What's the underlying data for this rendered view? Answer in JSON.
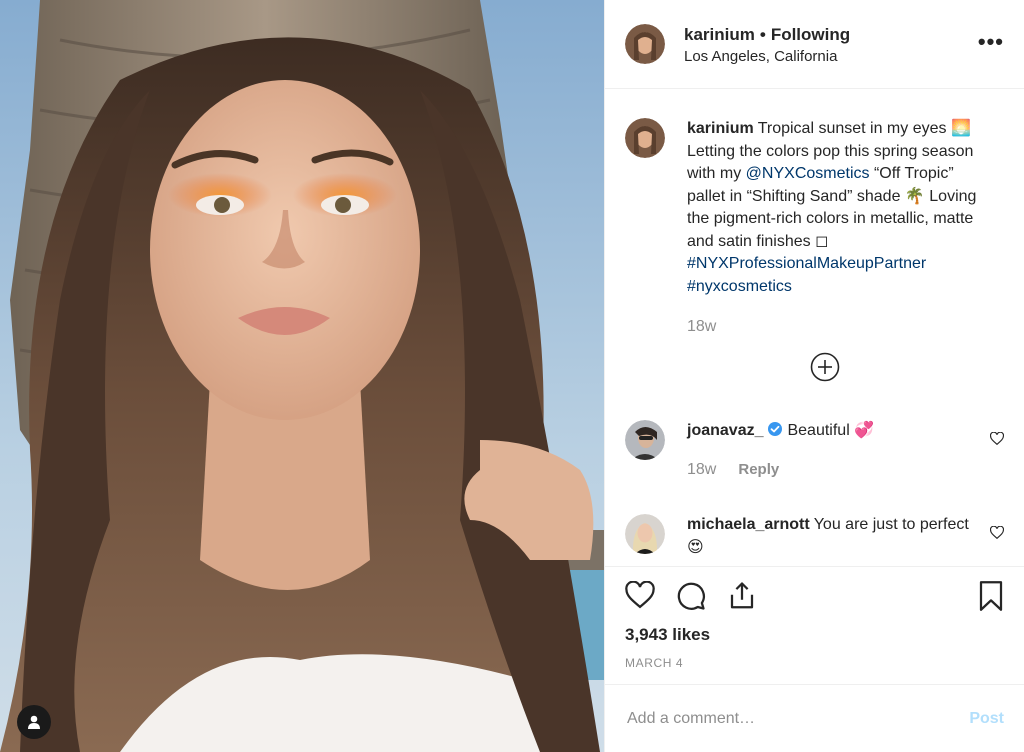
{
  "colors": {
    "text": "#262626",
    "muted": "#8e8e8e",
    "link": "#00376b",
    "post_disabled": "#b2dffc",
    "verified": "#3897f0",
    "border": "#efefef"
  },
  "post": {
    "photo_icon": "user-tag-icon"
  },
  "header": {
    "username": "karinium",
    "dot": "•",
    "follow_status": "Following",
    "location": "Los Angeles, California",
    "more_label": "•••"
  },
  "caption": {
    "username": "karinium",
    "text_1": "Tropical sunset in my eyes 🌅 Letting the colors pop this spring season with my ",
    "mention": "@NYXCosmetics",
    "text_2": " “Off Tropic” pallet in “Shifting Sand” shade 🌴  Loving the pigment-rich colors in metallic, matte and satin finishes ◻",
    "hashtag_1": "#NYXProfessionalMakeupPartner",
    "hashtag_2": "#nyxcosmetics",
    "time": "18w"
  },
  "comments": [
    {
      "username": "joanavaz_",
      "verified": true,
      "text": "Beautiful 💞",
      "time": "18w",
      "reply": "Reply"
    },
    {
      "username": "michaela_arnott",
      "verified": false,
      "text": "You are just to perfect 😍"
    }
  ],
  "actions": {
    "likes": "3,943 likes",
    "date": "MARCH 4"
  },
  "add_comment": {
    "placeholder": "Add a comment…",
    "post_label": "Post"
  }
}
